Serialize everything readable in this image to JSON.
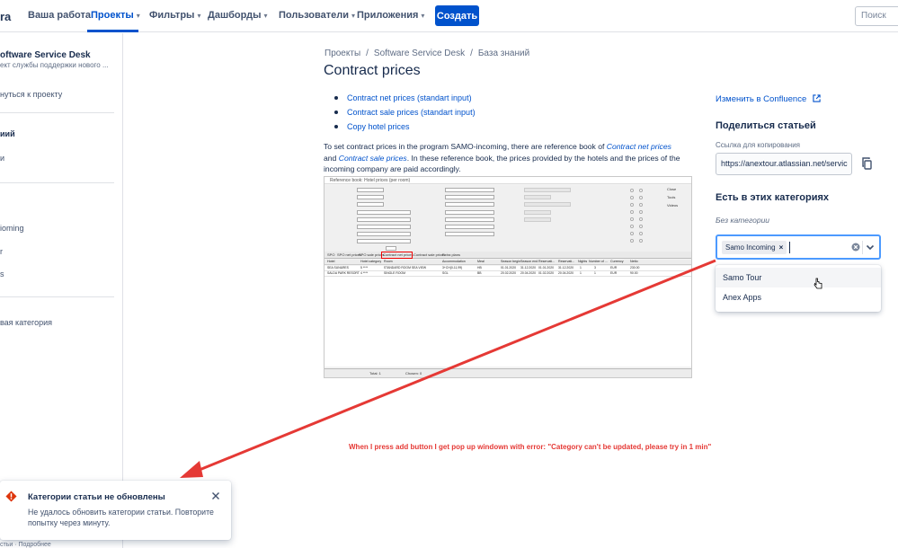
{
  "topnav": {
    "logo_fragment": "ra",
    "items": [
      {
        "label": "Ваша работа",
        "dropdown": false
      },
      {
        "label": "Проекты",
        "dropdown": true
      },
      {
        "label": "Фильтры",
        "dropdown": true
      },
      {
        "label": "Дашборды",
        "dropdown": true
      },
      {
        "label": "Пользователи",
        "dropdown": true
      },
      {
        "label": "Приложения",
        "dropdown": true
      }
    ],
    "chevron": "▾",
    "create_label": "Создать",
    "search_placeholder": "Поиск"
  },
  "sidebar": {
    "project_title": "oftware Service Desk",
    "project_subtitle": "ект службы поддержки нового ...",
    "back_link": "нуться к проекту",
    "items": [
      "иий",
      "и",
      "ioming",
      "r",
      "s"
    ],
    "new_category": "вая категория",
    "footer": "стьи · Подробнее"
  },
  "breadcrumb": [
    "Проекты",
    "Software Service Desk",
    "База знаний"
  ],
  "page_title": "Contract prices",
  "links": [
    "Contract net prices (standart input)",
    "Contract sale prices (standart input)",
    "Copy hotel prices"
  ],
  "paragraph": {
    "p1": "To set contract prices in the program SAMO-incoming, there are reference book of ",
    "link1": "Contract net prices",
    "p2": " and ",
    "link2": "Contract sale prices",
    "p3": ". In these reference book, the prices provided by the hotels and the prices of the incoming company are paid accordingly."
  },
  "embed": {
    "window_title": "Reference book: Hotel prices (per room)",
    "tabs": [
      "SPO",
      "SPO net prices",
      "SPO sale prices",
      "Contract net prices",
      "Contract sale prices",
      "Extra plans"
    ],
    "columns": [
      "Hotel",
      "Hotel category",
      "Room",
      "Accommodation",
      "Meal",
      "Season begin",
      "Season end",
      "Reservati...",
      "Reservati...",
      "Nights",
      "Number of ...",
      "Currency",
      "Netto"
    ],
    "rows": [
      [
        "SEA SUN&RES",
        "5 ****",
        "STANDARD ROOM SEA VIEW",
        "3+CH(0-11,99)",
        "HB",
        "01.01.2020",
        "31.12.2020",
        "01.01.2020",
        "31.12.2020",
        "1",
        "3",
        "EUR",
        "230.00"
      ],
      [
        "SALDA PARK RESORT",
        "4 ****",
        "SINGLE ROOM",
        "SGL",
        "BB",
        "20.02.2020",
        "20.04.2020",
        "01.02.2020",
        "20.04.2020",
        "1",
        "1",
        "EUR",
        "90.00"
      ]
    ],
    "status_total": "Total: 1",
    "status_chosen": "Chosen: 0",
    "buttons": [
      "Close",
      "Tools",
      "Videos"
    ]
  },
  "right_panel": {
    "edit_link": "Изменить в Confluence",
    "share_title": "Поделиться статьей",
    "copy_label": "Ссылка для копирования",
    "url_value": "https://anextour.atlassian.net/servic",
    "categories_title": "Есть в этих категориях",
    "no_category": "Без категории",
    "selected_chip": "Samo Incoming",
    "chip_remove": "×",
    "options": [
      "Samo Tour",
      "Anex Apps"
    ]
  },
  "annotation": "When I press add button I get pop up windown with error: \"Category can't be updated, please try in 1 min\"",
  "error_flag": {
    "title": "Категории статьи не обновлены",
    "body": "Не удалось обновить категории статьи. Повторите попытку через минуту."
  },
  "colors": {
    "primary": "#0052cc",
    "focus_border": "#4c9aff",
    "annotation": "#e53935",
    "error": "#de350b"
  }
}
